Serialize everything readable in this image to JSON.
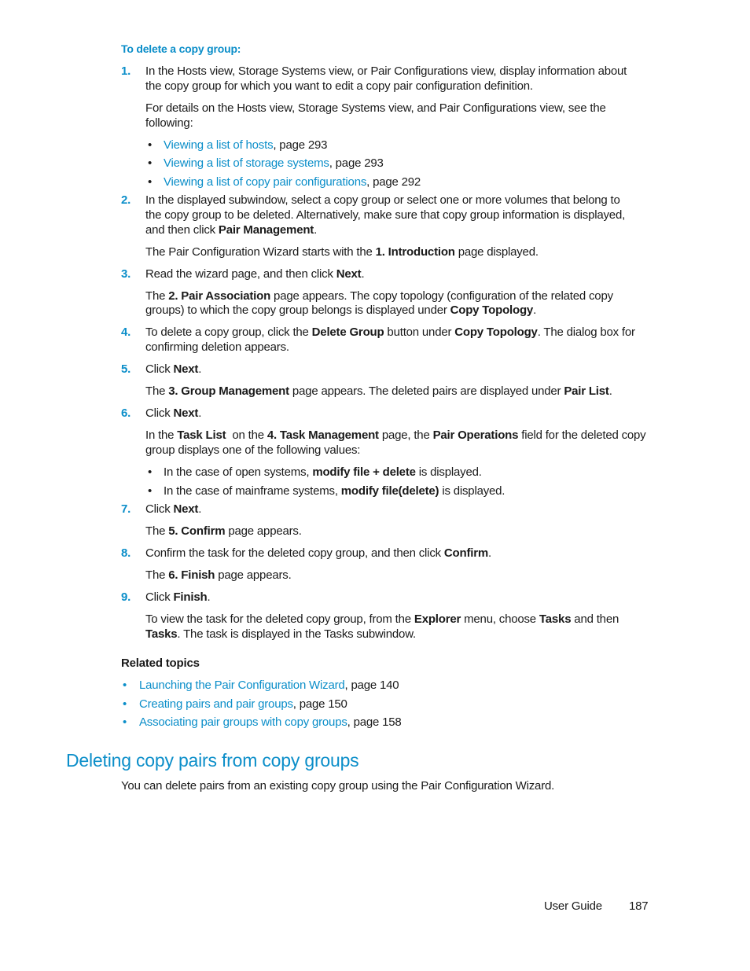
{
  "procedure": {
    "title": "To delete a copy group:",
    "steps": [
      {
        "num": "1.",
        "lines": [
          "In the Hosts view, Storage Systems view, or Pair Configurations view, display information about",
          "the copy group for which you want to edit a copy pair configuration definition."
        ],
        "note_lines": [
          "For details on the Hosts view, Storage Systems view, and Pair Configurations view, see the",
          "following:"
        ],
        "refs": [
          {
            "link": "Viewing a list of hosts",
            "suffix": ", page 293"
          },
          {
            "link": "Viewing a list of storage systems",
            "suffix": ", page 293"
          },
          {
            "link": "Viewing a list of copy pair configurations",
            "suffix": ", page 292"
          }
        ]
      },
      {
        "num": "2.",
        "line1": "In the displayed subwindow, select a copy group or select one or more volumes that belong to",
        "line2": "the copy group to be deleted. Alternatively, make sure that copy group information is displayed,",
        "line3_pre": "and then click ",
        "line3_bold": "Pair Management",
        "line3_post": ".",
        "note_pre": "The Pair Configuration Wizard starts with the ",
        "note_bold": "1. Introduction",
        "note_post": " page displayed."
      },
      {
        "num": "3.",
        "pre": "Read the wizard page, and then click ",
        "bold": "Next",
        "post": ".",
        "note1_pre": "The ",
        "note1_bold": "2. Pair Association",
        "note1_post": " page appears. The copy topology (configuration of the related copy",
        "note2_pre": "groups) to which the copy group belongs is displayed under ",
        "note2_bold": "Copy Topology",
        "note2_post": "."
      },
      {
        "num": "4.",
        "pre": "To delete a copy group, click the ",
        "bold1": "Delete Group",
        "mid": " button under ",
        "bold2": "Copy Topology",
        "post": ". The dialog box for",
        "line2": "confirming deletion appears."
      },
      {
        "num": "5.",
        "pre": "Click ",
        "bold": "Next",
        "post": ".",
        "note_pre": "The ",
        "note_bold1": "3. Group Management",
        "note_mid": " page appears. The deleted pairs are displayed under ",
        "note_bold2": "Pair List",
        "note_post": "."
      },
      {
        "num": "6.",
        "pre": "Click ",
        "bold": "Next",
        "post": ".",
        "note_a": "In the ",
        "note_b1": "Task List",
        "note_c": "  on the ",
        "note_b2": "4. Task Management",
        "note_d": " page, the ",
        "note_b3": "Pair Operations",
        "note_e": " field for the deleted copy",
        "note_line2": "group displays one of the following values:",
        "values": [
          {
            "pre": "In the case of open systems, ",
            "bold": "modify file + delete",
            "post": " is displayed."
          },
          {
            "pre": "In the case of mainframe systems, ",
            "bold": "modify file(delete)",
            "post": " is displayed."
          }
        ]
      },
      {
        "num": "7.",
        "pre": "Click ",
        "bold": "Next",
        "post": ".",
        "note_pre": "The ",
        "note_bold": "5. Confirm",
        "note_post": " page appears."
      },
      {
        "num": "8.",
        "pre": "Confirm the task for the deleted copy group, and then click ",
        "bold": "Confirm",
        "post": ".",
        "note_pre": "The ",
        "note_bold": "6. Finish",
        "note_post": " page appears."
      },
      {
        "num": "9.",
        "pre": "Click ",
        "bold": "Finish",
        "post": ".",
        "note1_pre": "To view the task for the deleted copy group, from the ",
        "note1_b1": "Explorer",
        "note1_mid": " menu, choose ",
        "note1_b2": "Tasks",
        "note1_post": " and then",
        "note2_bold": "Tasks",
        "note2_post": ". The task is displayed in the Tasks subwindow."
      }
    ]
  },
  "bullet_char": "•",
  "related_topics": {
    "title": "Related topics",
    "items": [
      {
        "link": "Launching the Pair Configuration Wizard",
        "suffix": ", page 140"
      },
      {
        "link": "Creating pairs and pair groups",
        "suffix": ", page 150"
      },
      {
        "link": "Associating pair groups with copy groups",
        "suffix": ", page 158"
      }
    ]
  },
  "section": {
    "heading": "Deleting copy pairs from copy groups",
    "body": "You can delete pairs from an existing copy group using the Pair Configuration Wizard."
  },
  "footer": {
    "label": "User Guide",
    "page": "187"
  }
}
